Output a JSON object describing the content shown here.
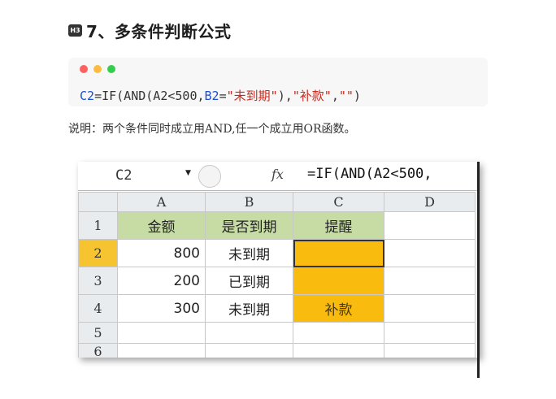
{
  "heading": {
    "badge": "H3",
    "text": "7、多条件判断公式"
  },
  "codeblock": {
    "tokens": [
      {
        "text": "C2",
        "kind": "ref"
      },
      {
        "text": "=IF(AND(A2<500,",
        "kind": "plain"
      },
      {
        "text": "B2",
        "kind": "ref"
      },
      {
        "text": "=",
        "kind": "plain"
      },
      {
        "text": "\"未到期\"",
        "kind": "str"
      },
      {
        "text": "),",
        "kind": "plain"
      },
      {
        "text": "\"补款\"",
        "kind": "str"
      },
      {
        "text": ",",
        "kind": "plain"
      },
      {
        "text": "\"\"",
        "kind": "str"
      },
      {
        "text": ")",
        "kind": "plain"
      }
    ],
    "colors": {
      "ref": "#1b4fd1",
      "str": "#c82a1d",
      "dot_red": "#fc625d",
      "dot_yellow": "#fdbc40",
      "dot_green": "#35cd4b"
    }
  },
  "description": "说明：两个条件同时成立用AND,任一个成立用OR函数。",
  "spreadsheet": {
    "name_box": "C2",
    "fx_label": "fx",
    "formula": "=IF(AND(A2<500,",
    "columns": [
      "A",
      "B",
      "C",
      "D"
    ],
    "rows": [
      {
        "num": "1",
        "cells": [
          "金额",
          "是否到期",
          "提醒",
          ""
        ]
      },
      {
        "num": "2",
        "cells": [
          "800",
          "未到期",
          "",
          ""
        ]
      },
      {
        "num": "3",
        "cells": [
          "200",
          "已到期",
          "",
          ""
        ]
      },
      {
        "num": "4",
        "cells": [
          "300",
          "未到期",
          "补款",
          ""
        ]
      },
      {
        "num": "5",
        "cells": [
          "",
          "",
          "",
          ""
        ]
      },
      {
        "num": "6",
        "cells": [
          "",
          "",
          "",
          ""
        ]
      }
    ],
    "colors": {
      "header_fill": "#c7dca5",
      "alert_fill": "#f9bb0e",
      "active_header": "#f5c430"
    }
  }
}
